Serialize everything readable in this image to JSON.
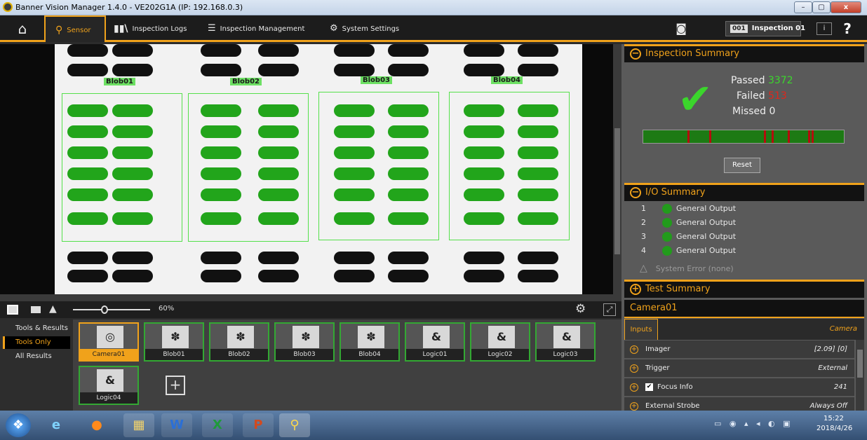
{
  "window": {
    "title": "Banner Vision Manager 1.4.0 - VE202G1A (IP: 192.168.0.3)",
    "min": "–",
    "max": "▢",
    "close": "x"
  },
  "menu": {
    "sensor": "Sensor",
    "logs": "Inspection Logs",
    "mgmt": "Inspection Management",
    "sys": "System Settings",
    "insp_num": "001",
    "insp_name": "Inspection 01",
    "info": "i",
    "help": "?"
  },
  "rois": [
    "Blob01",
    "Blob02",
    "Blob03",
    "Blob04"
  ],
  "zoom": "60%",
  "leftnav": [
    "Tools & Results",
    "Tools Only",
    "All Results"
  ],
  "tools": [
    {
      "name": "Camera01",
      "icon": "camera"
    },
    {
      "name": "Blob01",
      "icon": "blob"
    },
    {
      "name": "Blob02",
      "icon": "blob"
    },
    {
      "name": "Blob03",
      "icon": "blob"
    },
    {
      "name": "Blob04",
      "icon": "blob"
    },
    {
      "name": "Logic01",
      "icon": "logic"
    },
    {
      "name": "Logic02",
      "icon": "logic"
    },
    {
      "name": "Logic03",
      "icon": "logic"
    },
    {
      "name": "Logic04",
      "icon": "logic"
    }
  ],
  "summary": {
    "title": "Inspection Summary",
    "passed_label": "Passed",
    "passed": "3372",
    "failed_label": "Failed",
    "failed": "513",
    "missed_label": "Missed",
    "missed": "0",
    "reset": "Reset",
    "colors": {
      "passed": "#3bd62c",
      "failed": "#e0261b"
    }
  },
  "io": {
    "title": "I/O Summary",
    "rows": [
      {
        "n": "1",
        "label": "General Output"
      },
      {
        "n": "2",
        "label": "General Output"
      },
      {
        "n": "3",
        "label": "General Output"
      },
      {
        "n": "4",
        "label": "General Output"
      }
    ],
    "error": "System Error (none)"
  },
  "test": {
    "title": "Test Summary"
  },
  "camera": {
    "header": "Camera01",
    "tab_inputs": "Inputs",
    "tab_camera": "Camera",
    "props": [
      {
        "label": "Imager",
        "value": "[2.09]  [0]"
      },
      {
        "label": "Trigger",
        "value": "External"
      },
      {
        "label": "Focus Info",
        "value": "241"
      },
      {
        "label": "External Strobe",
        "value": "Always Off"
      }
    ]
  },
  "tray": {
    "time": "15:22",
    "date": "2018/4/26"
  },
  "accent": "#f0a21b"
}
